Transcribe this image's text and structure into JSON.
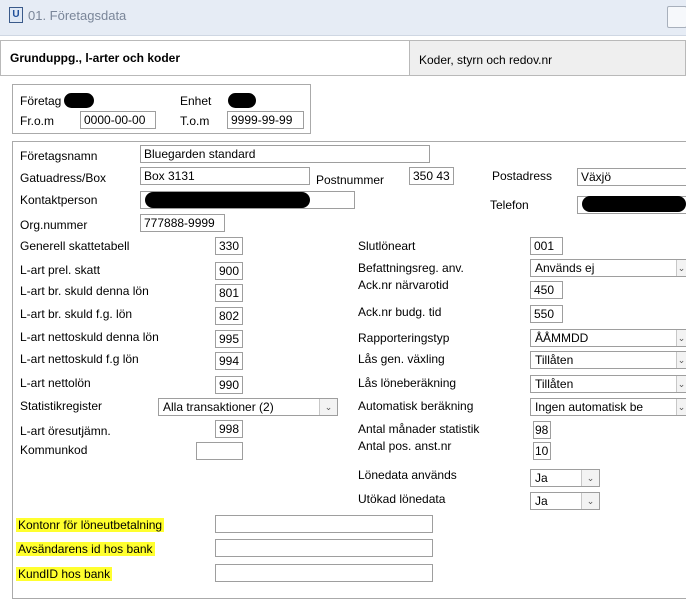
{
  "window": {
    "icon_glyph": "U",
    "title": "01. Företagsdata"
  },
  "tabs": [
    {
      "label": "Grunduppg., l-arter och koder"
    },
    {
      "label": "Koder, styrn och redov.nr"
    }
  ],
  "header": {
    "foretag_label": "Företag",
    "enhet_label": "Enhet",
    "from_label": "Fr.o.m",
    "from_value": "0000-00-00",
    "tom_label": "T.o.m",
    "tom_value": "9999-99-99"
  },
  "company": {
    "foretagsnamn_label": "Företagsnamn",
    "foretagsnamn_value": "Bluegarden standard",
    "gatuadress_label": "Gatuadress/Box",
    "gatuadress_value": "Box 3131",
    "postnummer_label": "Postnummer",
    "postnummer_value": "350 43",
    "postadress_label": "Postadress",
    "postadress_value": "Växjö",
    "kontaktperson_label": "Kontaktperson",
    "telefon_label": "Telefon",
    "orgnummer_label": "Org.nummer",
    "orgnummer_value": "777888-9999"
  },
  "left_fields": {
    "generell_label": "Generell skattetabell",
    "generell_value": "330",
    "prel_label": "L-art prel. skatt",
    "prel_value": "900",
    "brskuld_label": "L-art br. skuld denna lön",
    "brskuld_value": "801",
    "brskuldfg_label": "L-art br. skuld f.g. lön",
    "brskuldfg_value": "802",
    "netto_label": "L-art nettoskuld denna lön",
    "netto_value": "995",
    "nettofg_label": "L-art nettoskuld f.g lön",
    "nettofg_value": "994",
    "nettolon_label": "L-art nettolön",
    "nettolon_value": "990",
    "statistik_label": "Statistikregister",
    "statistik_value": "Alla transaktioner (2)",
    "ores_label": "L-art öresutjämn.",
    "ores_value": "998",
    "kommun_label": "Kommunkod",
    "kommun_value": ""
  },
  "right_fields": {
    "slutlon_label": "Slutlöneart",
    "slutlon_value": "001",
    "befatt_label": "Befattningsreg. anv.",
    "befatt_value": "Används ej",
    "narvaro_label": "Ack.nr närvarotid",
    "narvaro_value": "450",
    "budg_label": "Ack.nr budg. tid",
    "budg_value": "550",
    "rapp_label": "Rapporteringstyp",
    "rapp_value": "ÅÅMMDD",
    "vaxling_label": "Lås gen. växling",
    "vaxling_value": "Tillåten",
    "loneber_label": "Lås löneberäkning",
    "loneber_value": "Tillåten",
    "autober_label": "Automatisk beräkning",
    "autober_value": "Ingen automatisk be",
    "manader_label": "Antal månader statistik",
    "manader_value": "98",
    "posanst_label": "Antal pos. anst.nr",
    "posanst_value": "10",
    "lonedata_label": "Lönedata används",
    "lonedata_value": "Ja",
    "utokad_label": "Utökad lönedata",
    "utokad_value": "Ja"
  },
  "bank": {
    "kontonr_label": "Kontonr för löneutbetalning",
    "kontonr_value": "",
    "avsandare_label": "Avsändarens id hos bank",
    "avsandare_value": "",
    "kundid_label": "KundID hos bank",
    "kundid_value": ""
  },
  "colors": {
    "highlight": "#ffff2e",
    "titlebar": "#e6ecf5"
  }
}
